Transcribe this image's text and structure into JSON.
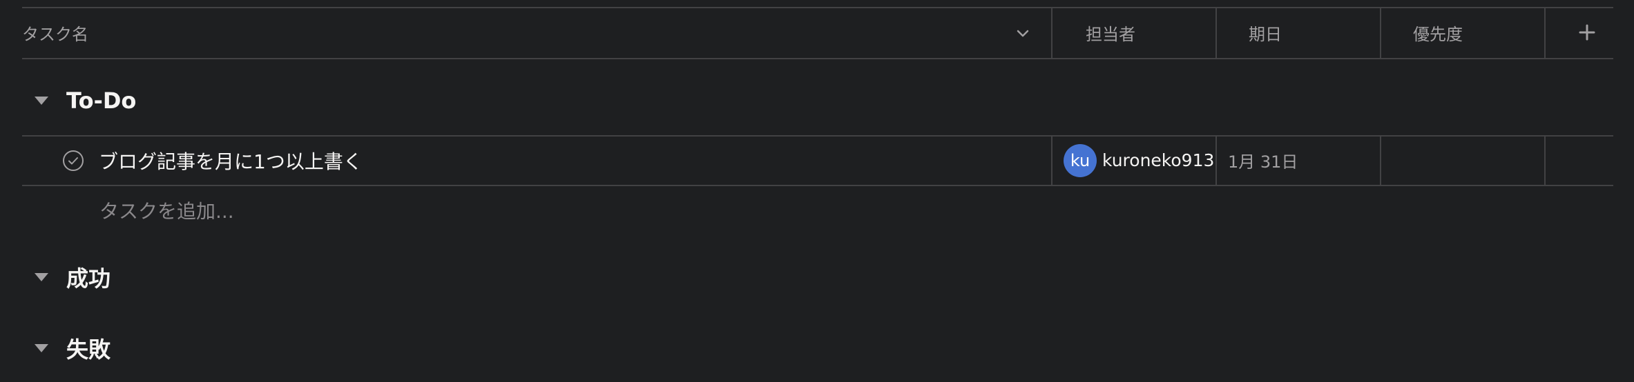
{
  "columns": {
    "task_name": "タスク名",
    "assignee": "担当者",
    "due_date": "期日",
    "priority": "優先度"
  },
  "sections": [
    {
      "title": "To-Do",
      "tasks": [
        {
          "name": "ブログ記事を月に1つ以上書く",
          "assignee_initials": "ku",
          "assignee_name": "kuroneko913",
          "due_date": "1月 31日",
          "priority": ""
        }
      ],
      "add_task_placeholder": "タスクを追加..."
    },
    {
      "title": "成功"
    },
    {
      "title": "失敗"
    }
  ],
  "icons": {
    "column_options": "chevron-down-icon",
    "add_column": "plus-icon",
    "section_toggle": "triangle-down-icon",
    "task_complete": "check-circle-icon"
  },
  "colors": {
    "background": "#1e1f21",
    "border": "#424244",
    "text_primary": "#f5f4f3",
    "text_secondary": "#a2a0a2",
    "avatar": "#4573d2"
  }
}
